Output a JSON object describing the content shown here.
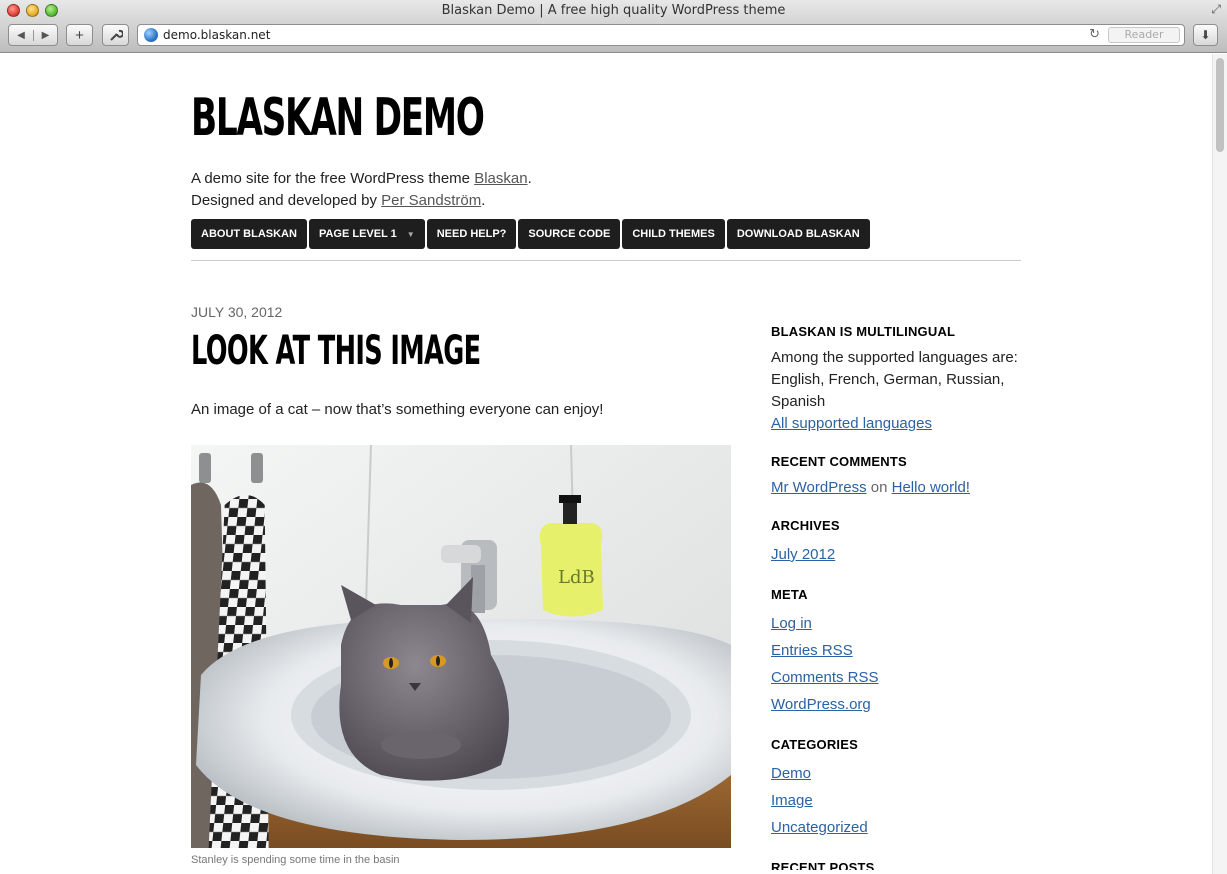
{
  "browser": {
    "window_title": "Blaskan Demo | A free high quality WordPress theme",
    "url": "demo.blaskan.net",
    "reader_label": "Reader"
  },
  "site": {
    "title": "BLASKAN DEMO",
    "tagline_line1_prefix": "A demo site for the free WordPress theme ",
    "tagline_link1": "Blaskan",
    "tagline_line1_suffix": ".",
    "tagline_line2_prefix": "Designed and developed by ",
    "tagline_link2": "Per Sandström",
    "tagline_line2_suffix": "."
  },
  "nav": {
    "items": [
      {
        "label": "ABOUT BLASKAN"
      },
      {
        "label": "PAGE LEVEL 1"
      },
      {
        "label": "NEED HELP?"
      },
      {
        "label": "SOURCE CODE"
      },
      {
        "label": "CHILD THEMES"
      },
      {
        "label": "DOWNLOAD BLASKAN"
      }
    ]
  },
  "post": {
    "date": "JULY 30, 2012",
    "title": "LOOK AT THIS IMAGE",
    "body": "An image of a cat – now that’s something everyone can enjoy!",
    "caption": "Stanley is spending some time in the basin",
    "bottle_label": "LdB"
  },
  "sidebar": {
    "multilingual": {
      "title": "BLASKAN IS MULTILINGUAL",
      "text": "Among the supported languages are: English, French, German, Russian, Spanish",
      "link": "All supported languages"
    },
    "recent_comments": {
      "title": "RECENT COMMENTS",
      "author": "Mr WordPress",
      "on": "on",
      "post": "Hello world!"
    },
    "archives": {
      "title": "ARCHIVES",
      "items": [
        "July 2012"
      ]
    },
    "meta": {
      "title": "META",
      "items": [
        "Log in",
        "Entries RSS",
        "Comments RSS",
        "WordPress.org"
      ]
    },
    "categories": {
      "title": "CATEGORIES",
      "items": [
        "Demo",
        "Image",
        "Uncategorized"
      ]
    },
    "recent_posts": {
      "title": "RECENT POSTS"
    }
  },
  "colors": {
    "nav_bg": "#1e1e1e",
    "link": "#2a62a4"
  }
}
